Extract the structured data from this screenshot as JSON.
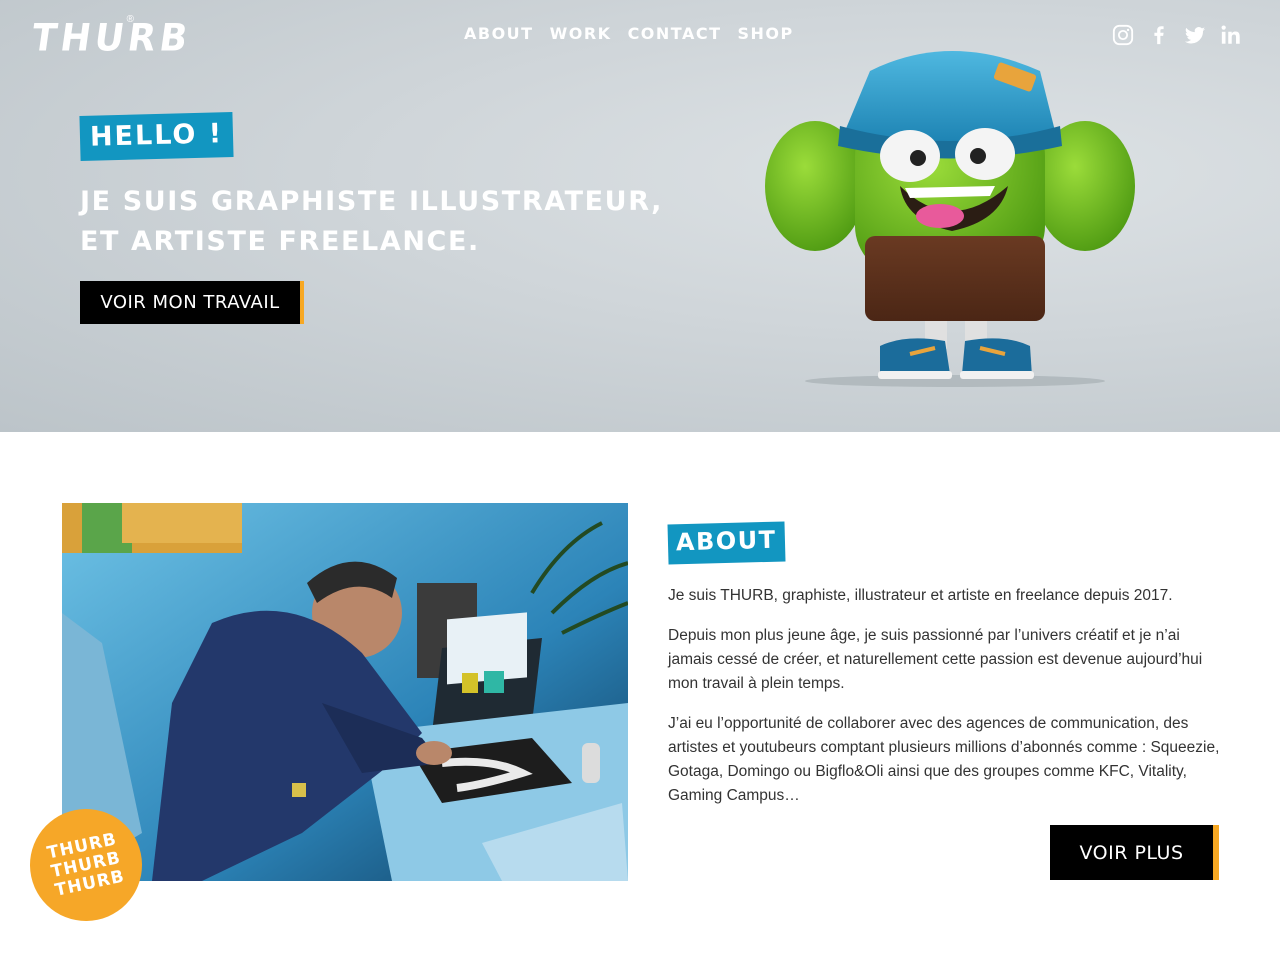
{
  "header": {
    "logo_text": "THURB",
    "logo_mark": "®",
    "nav": [
      "ABOUT",
      "WORK",
      "CONTACT",
      "SHOP"
    ],
    "social": [
      "instagram-icon",
      "facebook-icon",
      "twitter-icon",
      "linkedin-icon"
    ]
  },
  "hero": {
    "greeting": "HELLO !",
    "headline_line1": "JE SUIS GRAPHISTE ILLUSTRATEUR,",
    "headline_line2": "ET ARTISTE FREELANCE.",
    "cta_label": "VOIR MON TRAVAIL"
  },
  "about": {
    "tag": "ABOUT",
    "paragraphs": [
      "Je suis THURB, graphiste, illustrateur et artiste en freelance depuis 2017.",
      "Depuis mon plus jeune âge, je suis passionné par l’univers créatif et je n’ai jamais cessé de créer, et naturellement cette passion est devenue aujourd’hui mon travail à plein temps.",
      "J’ai eu l’opportunité de collaborer avec des agences de communication, des artistes et youtubeurs comptant plusieurs millions d’abonnés comme : Squeezie, Gotaga, Domingo ou Bigflo&Oli ainsi que des groupes comme KFC, Vitality, Gaming Campus…"
    ],
    "more_label": "VOIR PLUS",
    "badge_lines": [
      "THURB",
      "THURB",
      "THURB"
    ]
  },
  "colors": {
    "accent_blue": "#1296c1",
    "accent_orange": "#f7a823"
  }
}
